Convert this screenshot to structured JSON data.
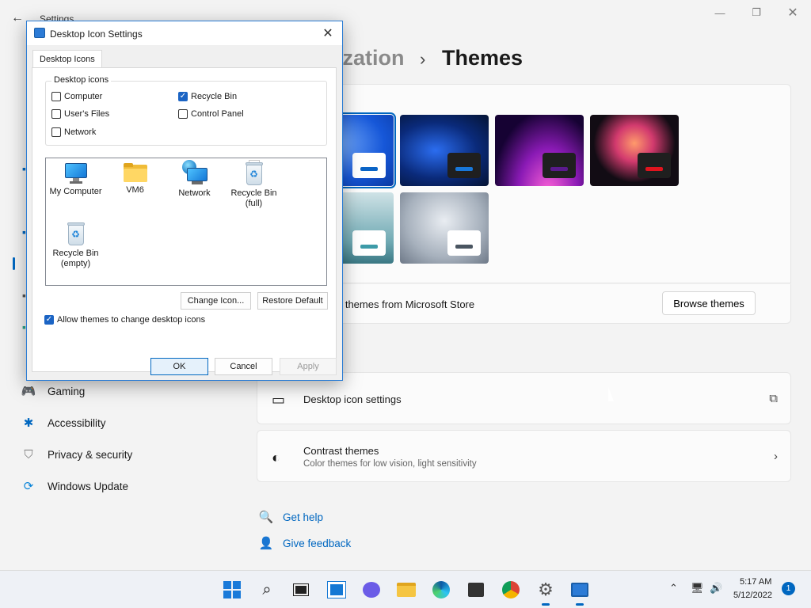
{
  "settings": {
    "app_title": "Settings",
    "breadcrumb_parent": "ization",
    "breadcrumb_sep": "›",
    "breadcrumb_current": "Themes",
    "store_text": "e themes from Microsoft Store",
    "browse_button": "Browse themes",
    "theme_swatch_colors": [
      "#0a64c6",
      "#1877d9",
      "#5a1a8c",
      "#e0141e",
      "#3d9ba8",
      "#4a5561"
    ],
    "rows": {
      "desktop_icon_settings": "Desktop icon settings",
      "contrast_title": "Contrast themes",
      "contrast_subtitle": "Color themes for low vision, light sensitivity"
    },
    "nav": [
      {
        "label": "Gaming",
        "icon": "gamepad-icon"
      },
      {
        "label": "Accessibility",
        "icon": "accessibility-icon"
      },
      {
        "label": "Privacy & security",
        "icon": "shield-icon"
      },
      {
        "label": "Windows Update",
        "icon": "update-icon"
      }
    ],
    "help": {
      "get_help": "Get help",
      "give_feedback": "Give feedback"
    },
    "accent": "#0067c0"
  },
  "dialog": {
    "title": "Desktop Icon Settings",
    "tab": "Desktop Icons",
    "group_label": "Desktop icons",
    "checkboxes": [
      {
        "label": "Computer",
        "checked": false
      },
      {
        "label": "User's Files",
        "checked": false
      },
      {
        "label": "Network",
        "checked": false
      },
      {
        "label": "Recycle Bin",
        "checked": true
      },
      {
        "label": "Control Panel",
        "checked": false
      }
    ],
    "icons": [
      {
        "label": "My Computer"
      },
      {
        "label": "VM6"
      },
      {
        "label": "Network"
      },
      {
        "label": "Recycle Bin (full)"
      },
      {
        "label": "Recycle Bin (empty)"
      }
    ],
    "change_icon": "Change Icon...",
    "restore_default": "Restore Default",
    "allow_themes": "Allow themes to change desktop icons",
    "allow_themes_checked": true,
    "ok": "OK",
    "cancel": "Cancel",
    "apply": "Apply"
  },
  "taskbar": {
    "time": "5:17 AM",
    "date": "5/12/2022",
    "notification_count": "1"
  }
}
